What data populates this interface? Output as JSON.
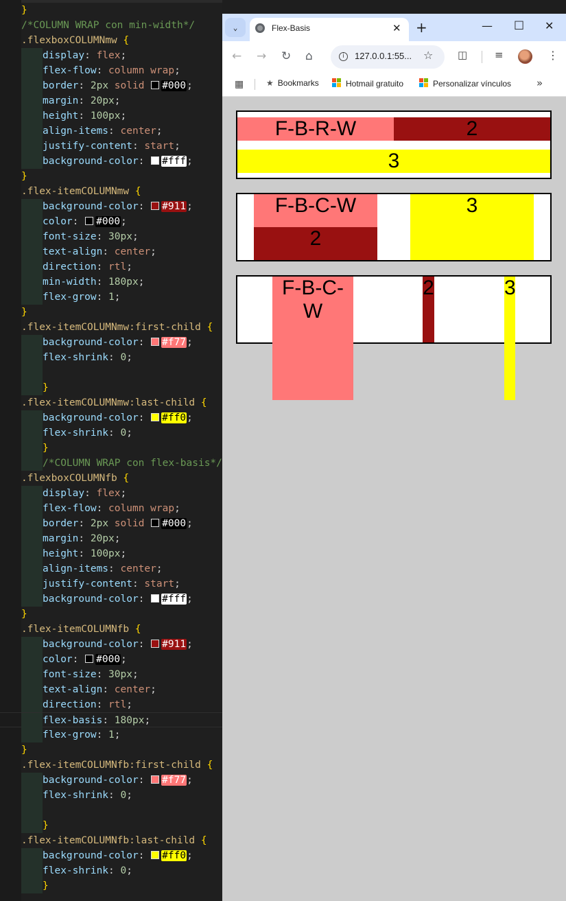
{
  "editor": {
    "lines": [
      [
        [
          "br",
          "}"
        ]
      ],
      [
        [
          "cm",
          "/*COLUMN WRAP con min-width*/"
        ]
      ],
      [
        [
          "sel",
          ".flexboxCOLUMNmw "
        ],
        [
          "br",
          "{"
        ]
      ],
      [
        [
          "ind",
          ""
        ],
        [
          "prop",
          "display"
        ],
        [
          "p",
          ": "
        ],
        [
          "kw",
          "flex"
        ],
        [
          "p",
          ";"
        ]
      ],
      [
        [
          "ind",
          ""
        ],
        [
          "prop",
          "flex-flow"
        ],
        [
          "p",
          ": "
        ],
        [
          "kw",
          "column wrap"
        ],
        [
          "p",
          ";"
        ]
      ],
      [
        [
          "ind",
          ""
        ],
        [
          "prop",
          "border"
        ],
        [
          "p",
          ": "
        ],
        [
          "num",
          "2px"
        ],
        [
          "p",
          " "
        ],
        [
          "kw",
          "solid"
        ],
        [
          "p",
          " "
        ],
        [
          "sw",
          "#000"
        ],
        [
          "chip",
          "#000"
        ],
        [
          "p",
          ";"
        ]
      ],
      [
        [
          "ind",
          ""
        ],
        [
          "prop",
          "margin"
        ],
        [
          "p",
          ": "
        ],
        [
          "num",
          "20px"
        ],
        [
          "p",
          ";"
        ]
      ],
      [
        [
          "ind",
          ""
        ],
        [
          "prop",
          "height"
        ],
        [
          "p",
          ": "
        ],
        [
          "num",
          "100px"
        ],
        [
          "p",
          ";"
        ]
      ],
      [
        [
          "ind",
          ""
        ],
        [
          "prop",
          "align-items"
        ],
        [
          "p",
          ": "
        ],
        [
          "kw",
          "center"
        ],
        [
          "p",
          ";"
        ]
      ],
      [
        [
          "ind",
          ""
        ],
        [
          "prop",
          "justify-content"
        ],
        [
          "p",
          ": "
        ],
        [
          "kw",
          "start"
        ],
        [
          "p",
          ";"
        ]
      ],
      [
        [
          "ind",
          ""
        ],
        [
          "prop",
          "background-color"
        ],
        [
          "p",
          ": "
        ],
        [
          "sw",
          "#fff"
        ],
        [
          "chip",
          "#fff"
        ],
        [
          "p",
          ";"
        ]
      ],
      [
        [
          "br",
          "}"
        ]
      ],
      [
        [
          "sel",
          ".flex-itemCOLUMNmw "
        ],
        [
          "br",
          "{"
        ]
      ],
      [
        [
          "ind",
          ""
        ],
        [
          "prop",
          "background-color"
        ],
        [
          "p",
          ": "
        ],
        [
          "sw",
          "#911"
        ],
        [
          "chip",
          "#911"
        ],
        [
          "p",
          ";"
        ]
      ],
      [
        [
          "ind",
          ""
        ],
        [
          "prop",
          "color"
        ],
        [
          "p",
          ": "
        ],
        [
          "sw",
          "#000"
        ],
        [
          "chip",
          "#000"
        ],
        [
          "p",
          ";"
        ]
      ],
      [
        [
          "ind",
          ""
        ],
        [
          "prop",
          "font-size"
        ],
        [
          "p",
          ": "
        ],
        [
          "num",
          "30px"
        ],
        [
          "p",
          ";"
        ]
      ],
      [
        [
          "ind",
          ""
        ],
        [
          "prop",
          "text-align"
        ],
        [
          "p",
          ": "
        ],
        [
          "kw",
          "center"
        ],
        [
          "p",
          ";"
        ]
      ],
      [
        [
          "ind",
          ""
        ],
        [
          "prop",
          "direction"
        ],
        [
          "p",
          ": "
        ],
        [
          "kw",
          "rtl"
        ],
        [
          "p",
          ";"
        ]
      ],
      [
        [
          "ind",
          ""
        ],
        [
          "prop",
          "min-width"
        ],
        [
          "p",
          ": "
        ],
        [
          "num",
          "180px"
        ],
        [
          "p",
          ";"
        ]
      ],
      [
        [
          "ind",
          ""
        ],
        [
          "prop",
          "flex-grow"
        ],
        [
          "p",
          ": "
        ],
        [
          "num",
          "1"
        ],
        [
          "p",
          ";"
        ]
      ],
      [
        [
          "br",
          "}"
        ]
      ],
      [
        [
          "sel",
          ".flex-itemCOLUMNmw:first-child "
        ],
        [
          "br",
          "{"
        ]
      ],
      [
        [
          "ind",
          ""
        ],
        [
          "prop",
          "background-color"
        ],
        [
          "p",
          ": "
        ],
        [
          "sw",
          "#f77"
        ],
        [
          "chip",
          "#f77"
        ],
        [
          "p",
          ";"
        ]
      ],
      [
        [
          "ind",
          ""
        ],
        [
          "prop",
          "flex-shrink"
        ],
        [
          "p",
          ": "
        ],
        [
          "num",
          "0"
        ],
        [
          "p",
          ";"
        ]
      ],
      [
        [
          "ind",
          ""
        ]
      ],
      [
        [
          "ind",
          ""
        ],
        [
          "br",
          "}"
        ]
      ],
      [
        [
          "sel",
          ".flex-itemCOLUMNmw:last-child "
        ],
        [
          "br",
          "{"
        ]
      ],
      [
        [
          "ind",
          ""
        ],
        [
          "prop",
          "background-color"
        ],
        [
          "p",
          ": "
        ],
        [
          "sw",
          "#ff0"
        ],
        [
          "chip",
          "#ff0"
        ],
        [
          "p",
          ";"
        ]
      ],
      [
        [
          "ind",
          ""
        ],
        [
          "prop",
          "flex-shrink"
        ],
        [
          "p",
          ": "
        ],
        [
          "num",
          "0"
        ],
        [
          "p",
          ";"
        ]
      ],
      [
        [
          "ind",
          ""
        ],
        [
          "br",
          "}"
        ]
      ],
      [
        [
          "ind",
          ""
        ],
        [
          "cm",
          "/*COLUMN WRAP con flex-basis*/"
        ]
      ],
      [
        [
          "sel",
          ".flexboxCOLUMNfb "
        ],
        [
          "br",
          "{"
        ]
      ],
      [
        [
          "ind",
          ""
        ],
        [
          "prop",
          "display"
        ],
        [
          "p",
          ": "
        ],
        [
          "kw",
          "flex"
        ],
        [
          "p",
          ";"
        ]
      ],
      [
        [
          "ind",
          ""
        ],
        [
          "prop",
          "flex-flow"
        ],
        [
          "p",
          ": "
        ],
        [
          "kw",
          "column wrap"
        ],
        [
          "p",
          ";"
        ]
      ],
      [
        [
          "ind",
          ""
        ],
        [
          "prop",
          "border"
        ],
        [
          "p",
          ": "
        ],
        [
          "num",
          "2px"
        ],
        [
          "p",
          " "
        ],
        [
          "kw",
          "solid"
        ],
        [
          "p",
          " "
        ],
        [
          "sw",
          "#000"
        ],
        [
          "chip",
          "#000"
        ],
        [
          "p",
          ";"
        ]
      ],
      [
        [
          "ind",
          ""
        ],
        [
          "prop",
          "margin"
        ],
        [
          "p",
          ": "
        ],
        [
          "num",
          "20px"
        ],
        [
          "p",
          ";"
        ]
      ],
      [
        [
          "ind",
          ""
        ],
        [
          "prop",
          "height"
        ],
        [
          "p",
          ": "
        ],
        [
          "num",
          "100px"
        ],
        [
          "p",
          ";"
        ]
      ],
      [
        [
          "ind",
          ""
        ],
        [
          "prop",
          "align-items"
        ],
        [
          "p",
          ": "
        ],
        [
          "kw",
          "center"
        ],
        [
          "p",
          ";"
        ]
      ],
      [
        [
          "ind",
          ""
        ],
        [
          "prop",
          "justify-content"
        ],
        [
          "p",
          ": "
        ],
        [
          "kw",
          "start"
        ],
        [
          "p",
          ";"
        ]
      ],
      [
        [
          "ind",
          ""
        ],
        [
          "prop",
          "background-color"
        ],
        [
          "p",
          ": "
        ],
        [
          "sw",
          "#fff"
        ],
        [
          "chip",
          "#fff"
        ],
        [
          "p",
          ";"
        ]
      ],
      [
        [
          "br",
          "}"
        ]
      ],
      [
        [
          "sel",
          ".flex-itemCOLUMNfb "
        ],
        [
          "br",
          "{"
        ]
      ],
      [
        [
          "ind",
          ""
        ],
        [
          "prop",
          "background-color"
        ],
        [
          "p",
          ": "
        ],
        [
          "sw",
          "#911"
        ],
        [
          "chip",
          "#911"
        ],
        [
          "p",
          ";"
        ]
      ],
      [
        [
          "ind",
          ""
        ],
        [
          "prop",
          "color"
        ],
        [
          "p",
          ": "
        ],
        [
          "sw",
          "#000"
        ],
        [
          "chip",
          "#000"
        ],
        [
          "p",
          ";"
        ]
      ],
      [
        [
          "ind",
          ""
        ],
        [
          "prop",
          "font-size"
        ],
        [
          "p",
          ": "
        ],
        [
          "num",
          "30px"
        ],
        [
          "p",
          ";"
        ]
      ],
      [
        [
          "ind",
          ""
        ],
        [
          "prop",
          "text-align"
        ],
        [
          "p",
          ": "
        ],
        [
          "kw",
          "center"
        ],
        [
          "p",
          ";"
        ]
      ],
      [
        [
          "ind",
          ""
        ],
        [
          "prop",
          "direction"
        ],
        [
          "p",
          ": "
        ],
        [
          "kw",
          "rtl"
        ],
        [
          "p",
          ";"
        ]
      ],
      [
        [
          "ind",
          ""
        ],
        [
          "prop",
          "flex-basis"
        ],
        [
          "p",
          ": "
        ],
        [
          "num",
          "180px"
        ],
        [
          "p",
          ";"
        ]
      ],
      [
        [
          "ind",
          ""
        ],
        [
          "prop",
          "flex-grow"
        ],
        [
          "p",
          ": "
        ],
        [
          "num",
          "1"
        ],
        [
          "p",
          ";"
        ]
      ],
      [
        [
          "br",
          "}"
        ]
      ],
      [
        [
          "sel",
          ".flex-itemCOLUMNfb:first-child "
        ],
        [
          "br",
          "{"
        ]
      ],
      [
        [
          "ind",
          ""
        ],
        [
          "prop",
          "background-color"
        ],
        [
          "p",
          ": "
        ],
        [
          "sw",
          "#f77"
        ],
        [
          "chip",
          "#f77"
        ],
        [
          "p",
          ";"
        ]
      ],
      [
        [
          "ind",
          ""
        ],
        [
          "prop",
          "flex-shrink"
        ],
        [
          "p",
          ": "
        ],
        [
          "num",
          "0"
        ],
        [
          "p",
          ";"
        ]
      ],
      [
        [
          "ind",
          ""
        ]
      ],
      [
        [
          "ind",
          ""
        ],
        [
          "br",
          "}"
        ]
      ],
      [
        [
          "sel",
          ".flex-itemCOLUMNfb:last-child "
        ],
        [
          "br",
          "{"
        ]
      ],
      [
        [
          "ind",
          ""
        ],
        [
          "prop",
          "background-color"
        ],
        [
          "p",
          ": "
        ],
        [
          "sw",
          "#ff0"
        ],
        [
          "chip",
          "#ff0"
        ],
        [
          "p",
          ";"
        ]
      ],
      [
        [
          "ind",
          ""
        ],
        [
          "prop",
          "flex-shrink"
        ],
        [
          "p",
          ": "
        ],
        [
          "num",
          "0"
        ],
        [
          "p",
          ";"
        ]
      ],
      [
        [
          "ind",
          ""
        ],
        [
          "br",
          "}"
        ]
      ]
    ],
    "active_line": 47
  },
  "browser": {
    "tab_title": "Flex-Basis",
    "url": "127.0.0.1:55...",
    "bookmarks": [
      {
        "label": "Bookmarks",
        "icon": "star-icon"
      },
      {
        "label": "Hotmail gratuito",
        "icon": "microsoft-logo-icon"
      },
      {
        "label": "Personalizar vínculos",
        "icon": "microsoft-logo-icon"
      }
    ]
  },
  "page": {
    "box1": {
      "items": [
        "F-B-R-W",
        "2",
        "3"
      ]
    },
    "box2": {
      "items": [
        "F-B-C-W",
        "2",
        "3"
      ]
    },
    "box3": {
      "items": [
        "F-B-C-W",
        "2",
        "3"
      ]
    }
  },
  "colors": {
    "salmon": "#ff7777",
    "darkred": "#991111",
    "yellow": "#ffff00"
  }
}
